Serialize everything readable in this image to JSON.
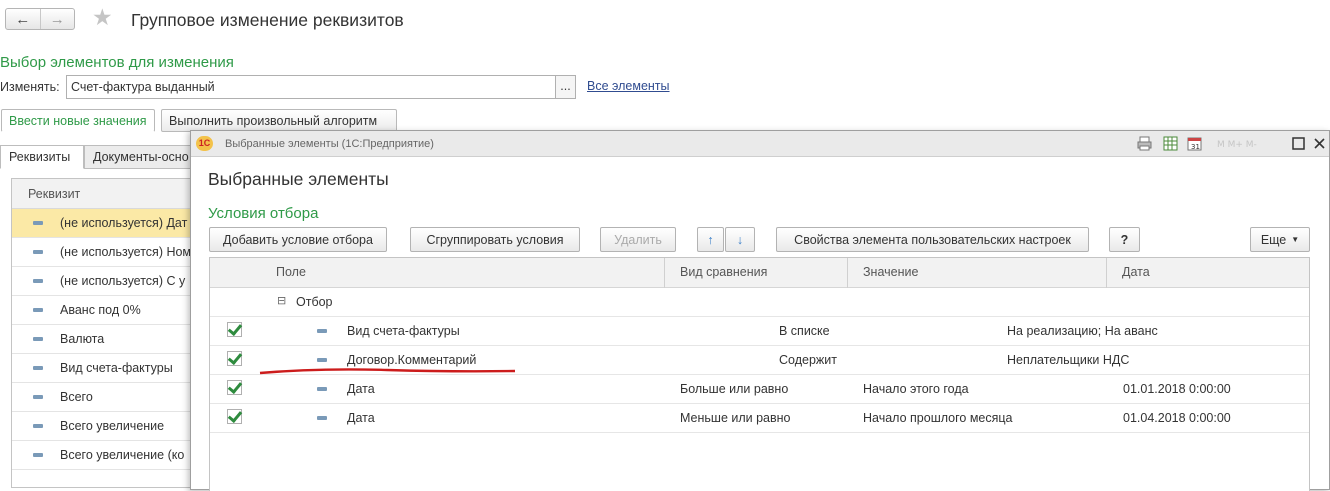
{
  "window": {
    "title": "Групповое изменение реквизитов",
    "back_icon": "arrow-left-icon",
    "forward_icon": "arrow-right-icon",
    "favorite_icon": "star-icon"
  },
  "selection": {
    "section_title": "Выбор элементов для изменения",
    "change_label": "Изменять:",
    "change_value": "Счет-фактура выданный",
    "select_button": "...",
    "all_elements_link": "Все элементы"
  },
  "mode_tabs": [
    "Ввести новые значения",
    "Выполнить произвольный алгоритм"
  ],
  "inner_tabs": [
    "Реквизиты",
    "Документы-осно"
  ],
  "attributes": {
    "header": "Реквизит",
    "rows": [
      "(не используется) Дат",
      "(не используется) Ном",
      "(не используется) С у",
      "Аванс под 0%",
      "Валюта",
      "Вид счета-фактуры",
      "Всего",
      "Всего увеличение",
      "Всего увеличение (ко"
    ]
  },
  "dialog": {
    "window_title": "Выбранные элементы  (1С:Предприятие)",
    "logo": "1С",
    "heading": "Выбранные элементы",
    "section_title": "Условия отбора",
    "buttons": {
      "add": "Добавить условие отбора",
      "group": "Сгруппировать условия",
      "delete": "Удалить",
      "up": "↑",
      "down": "↓",
      "properties": "Свойства элемента пользовательских настроек",
      "help": "?",
      "more": "Еще"
    },
    "columns": [
      "Поле",
      "Вид сравнения",
      "Значение",
      "Дата"
    ],
    "group_row": "Отбор",
    "rows": [
      {
        "field": "Вид счета-фактуры",
        "comparison": "В списке",
        "value": "На реализацию; На аванс",
        "date": ""
      },
      {
        "field": "Договор.Комментарий",
        "comparison": "Содержит",
        "value": "Неплательщики НДС",
        "date": ""
      },
      {
        "field": "Дата",
        "comparison": "Больше или равно",
        "value": "Начало этого года",
        "date": "01.01.2018 0:00:00"
      },
      {
        "field": "Дата",
        "comparison": "Меньше или равно",
        "value": "Начало прошлого месяца",
        "date": "01.04.2018 0:00:00"
      }
    ]
  },
  "colors": {
    "accent_green": "#2f9a48",
    "link_blue": "#304c90",
    "selected_row": "#fbe9a6",
    "annotation_red": "#cc1c1c"
  }
}
